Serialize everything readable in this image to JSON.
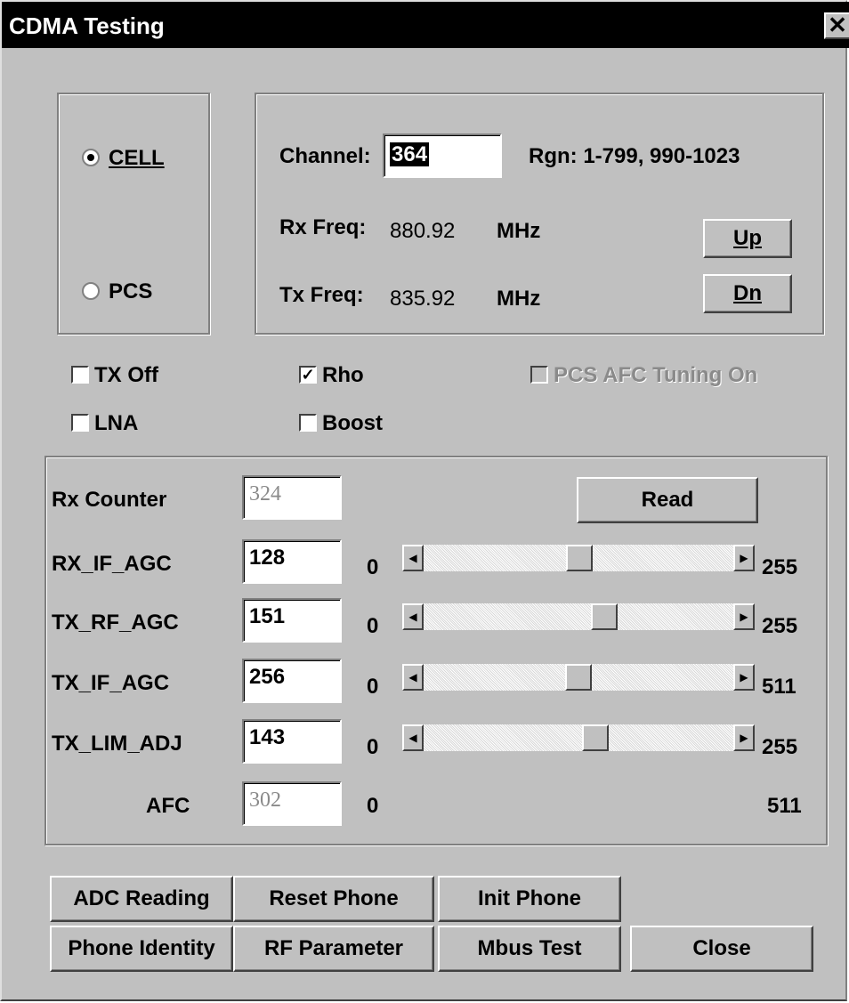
{
  "window": {
    "title": "CDMA Testing",
    "close_glyph": "✕"
  },
  "band": {
    "cell_label": "CELL",
    "pcs_label": "PCS",
    "selected": "CELL"
  },
  "channel": {
    "label": "Channel:",
    "value": "364",
    "range_text": "Rgn: 1-799, 990-1023",
    "rx_label": "Rx Freq:",
    "rx_value": "880.92",
    "rx_unit": "MHz",
    "tx_label": "Tx Freq:",
    "tx_value": "835.92",
    "tx_unit": "MHz",
    "up_label": "Up",
    "dn_label": "Dn"
  },
  "options": {
    "tx_off": {
      "label": "TX Off",
      "checked": false
    },
    "rho": {
      "label": "Rho",
      "checked": true
    },
    "pcs_afc": {
      "label": "PCS AFC Tuning On",
      "checked": false,
      "disabled": true
    },
    "lna": {
      "label": "LNA",
      "checked": false
    },
    "boost": {
      "label": "Boost",
      "checked": false
    }
  },
  "agc": {
    "rx_counter_label": "Rx Counter",
    "rx_counter_value": "324",
    "read_label": "Read",
    "rows": [
      {
        "label": "RX_IF_AGC",
        "value": "128",
        "min": "0",
        "max": "255",
        "slider_fraction": 0.502
      },
      {
        "label": "TX_RF_AGC",
        "value": "151",
        "min": "0",
        "max": "255",
        "slider_fraction": 0.592
      },
      {
        "label": "TX_IF_AGC",
        "value": "256",
        "min": "0",
        "max": "511",
        "slider_fraction": 0.501
      },
      {
        "label": "TX_LIM_ADJ",
        "value": "143",
        "min": "0",
        "max": "255",
        "slider_fraction": 0.561
      }
    ],
    "afc": {
      "label": "AFC",
      "value": "302",
      "min": "0",
      "max": "511"
    }
  },
  "buttons": {
    "adc": "ADC Reading",
    "reset": "Reset Phone",
    "init": "Init Phone",
    "identity": "Phone Identity",
    "rf": "RF Parameter",
    "mbus": "Mbus Test",
    "close": "Close"
  }
}
